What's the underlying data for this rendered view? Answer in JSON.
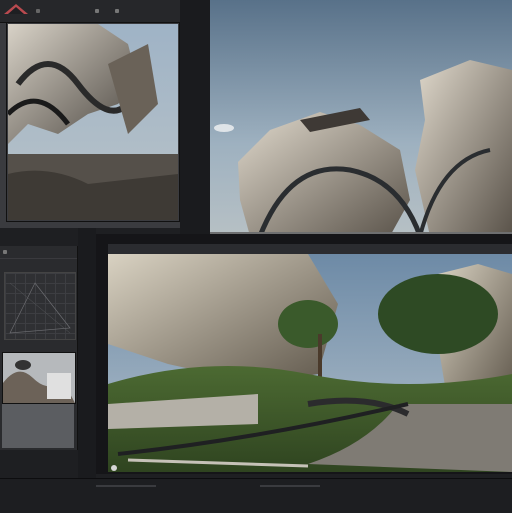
{
  "app": {
    "accent": "#c8353a"
  },
  "panels": {
    "top_left_viewport": {
      "name": "viewport-top-left"
    },
    "top_right_viewport": {
      "name": "viewport-top-right"
    },
    "side_panel": {
      "name": "side-panel"
    },
    "bottom_viewport": {
      "name": "viewport-bottom"
    }
  },
  "statusbar": {
    "brand_label": ""
  },
  "icons": [
    "logo-icon",
    "window-button-icon",
    "grid-icon",
    "play-icon"
  ]
}
